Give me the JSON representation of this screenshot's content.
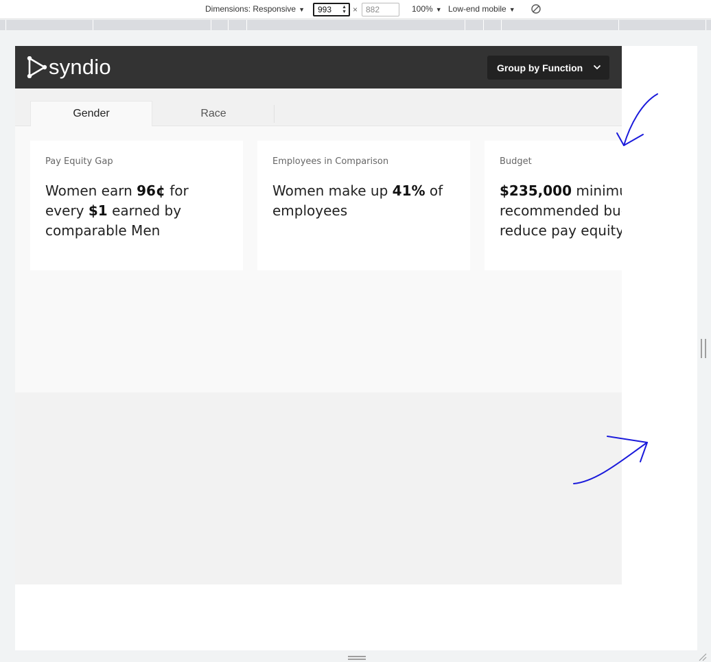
{
  "devtools": {
    "dimensions_label": "Dimensions: Responsive",
    "width_value": "993",
    "height_placeholder": "882",
    "times_sign": "×",
    "zoom": "100%",
    "throttle": "Low-end mobile"
  },
  "app": {
    "logo_text": "syndio",
    "group_button_label": "Group by Function",
    "tabs": [
      {
        "label": "Gender"
      },
      {
        "label": "Race"
      }
    ],
    "cards": [
      {
        "label": "Pay Equity Gap",
        "parts": [
          "Women earn ",
          "96¢",
          " for every ",
          "$1",
          " earned by comparable Men"
        ]
      },
      {
        "label": "Employees in Comparison",
        "parts": [
          "Women make up ",
          "41%",
          " of employees"
        ]
      },
      {
        "label": "Budget",
        "parts": [
          "$235,000",
          " minimum recommended buget to reduce pay equity gap"
        ]
      }
    ]
  },
  "colors": {
    "header_bg": "#333333",
    "button_bg": "#222222",
    "annotation": "#1a1adb"
  }
}
